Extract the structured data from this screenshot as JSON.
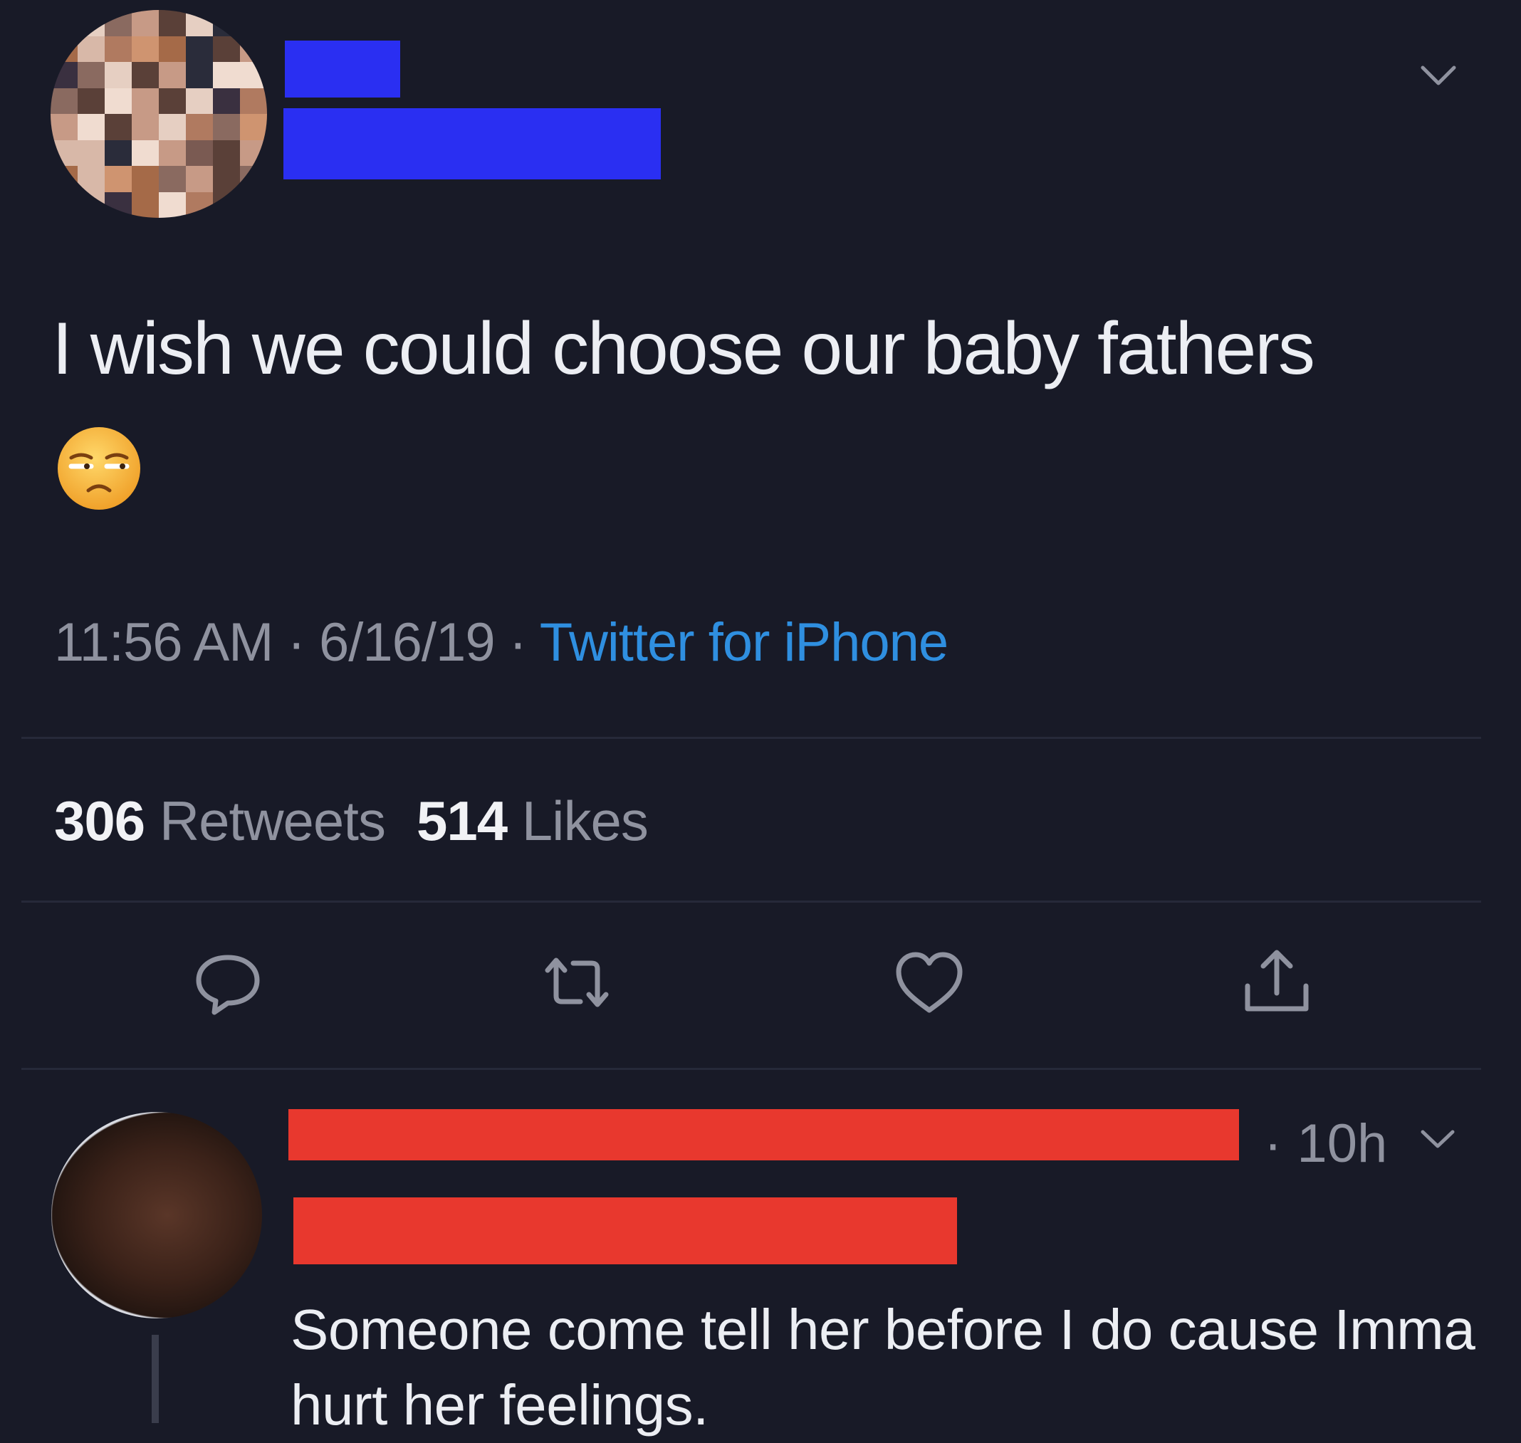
{
  "tweet": {
    "text": "I wish we could choose our baby fathers",
    "emoji": "unamused-face",
    "time": "11:56 AM",
    "date": "6/16/19",
    "separator": " · ",
    "source": "Twitter for iPhone",
    "retweets_count": "306",
    "retweets_label": "Retweets",
    "likes_count": "514",
    "likes_label": "Likes"
  },
  "actions": {
    "icons": [
      "reply-icon",
      "retweet-icon",
      "like-icon",
      "share-icon"
    ]
  },
  "reply": {
    "time": "· 10h",
    "text": "Someone come tell her before I do cause Imma hurt her feelings."
  },
  "colors": {
    "background": "#181a27",
    "link": "#2f8fe0",
    "redaction_blue": "#2a2ff2",
    "redaction_red": "#e8382e",
    "muted": "#8f929f"
  }
}
